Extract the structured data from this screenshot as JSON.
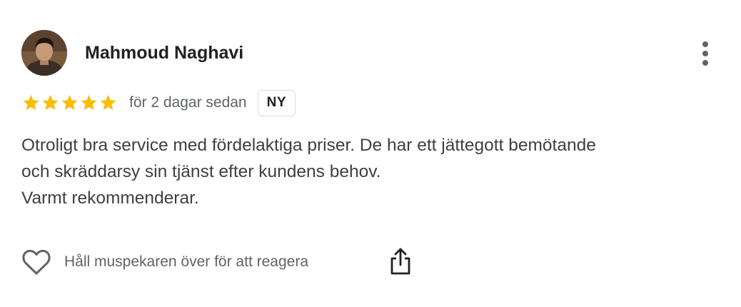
{
  "reviewer": {
    "name": "Mahmoud Naghavi",
    "avatar_icon": "user-avatar-photo"
  },
  "more_menu": {
    "icon": "more-vertical-icon"
  },
  "rating": {
    "stars": 5,
    "max_stars": 5,
    "star_color": "#fbbc04",
    "time_ago": "för 2 dagar sedan",
    "badge": "NY"
  },
  "review": {
    "lines": [
      "Otroligt bra service med fördelaktiga priser. De har ett jättegott bemötande",
      "och skräddarsy sin tjänst efter kundens behov.",
      "Varmt rekommenderar."
    ]
  },
  "actions": {
    "react_icon": "heart-icon",
    "react_label": "Håll muspekaren över för att reagera",
    "share_icon": "share-icon"
  }
}
